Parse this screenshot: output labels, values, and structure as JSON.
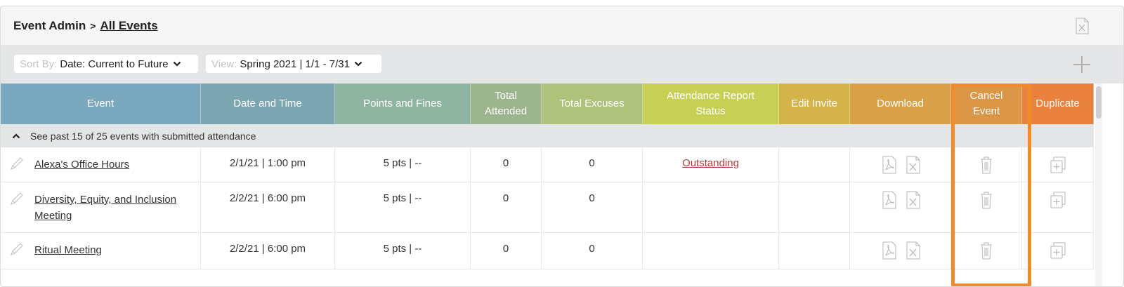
{
  "header": {
    "section": "Event Admin",
    "current": "All Events"
  },
  "toolbar": {
    "sort": {
      "placeholder": "Sort By:",
      "value": "Date: Current to Future"
    },
    "view": {
      "placeholder": "View:",
      "value": "Spring 2021 | 1/1 - 7/31"
    }
  },
  "columns": [
    {
      "label": "Event",
      "color": "#7aa9bf"
    },
    {
      "label": "Date and Time",
      "color": "#7ba6b1"
    },
    {
      "label": "Points and Fines",
      "color": "#8fb4a2"
    },
    {
      "label": "Total Attended",
      "color": "#9db58f"
    },
    {
      "label": "Total Excuses",
      "color": "#aec27c"
    },
    {
      "label": "Attendance Report Status",
      "color": "#c7cf55"
    },
    {
      "label": "Edit Invite",
      "color": "#d3b34a"
    },
    {
      "label": "Download",
      "color": "#d9a148"
    },
    {
      "label": "Cancel Event",
      "color": "#db9647"
    },
    {
      "label": "Duplicate",
      "color": "#e9823f"
    }
  ],
  "past_events_toggle": "See past 15 of 25 events with submitted attendance",
  "rows": [
    {
      "event": "Alexa's Office Hours",
      "datetime": "2/1/21 | 1:00 pm",
      "points": "5 pts | --",
      "attended": "0",
      "excuses": "0",
      "status": "Outstanding"
    },
    {
      "event": "Diversity, Equity, and Inclusion Meeting",
      "datetime": "2/2/21 | 6:00 pm",
      "points": "5 pts | --",
      "attended": "0",
      "excuses": "0",
      "status": ""
    },
    {
      "event": "Ritual Meeting",
      "datetime": "2/2/21 | 6:00 pm",
      "points": "5 pts | --",
      "attended": "0",
      "excuses": "0",
      "status": ""
    }
  ],
  "colors": {
    "highlight": "#f08a2a",
    "status_link": "#b03a3a",
    "icon_gray": "#b5b5b5"
  },
  "icons": [
    "excel-icon",
    "add-icon",
    "pencil-icon",
    "pdf-icon",
    "trash-icon",
    "duplicate-icon",
    "chevron-down-icon",
    "caret-up-icon"
  ]
}
